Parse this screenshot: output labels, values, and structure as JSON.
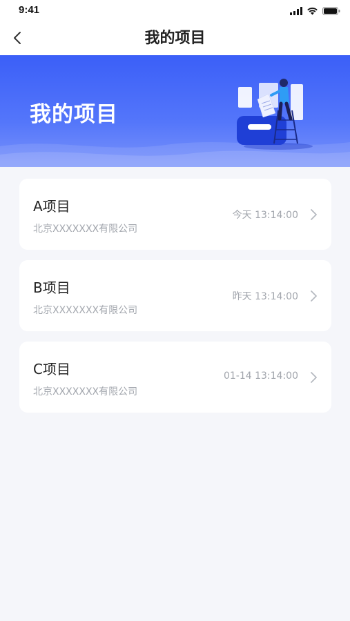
{
  "status_bar": {
    "time": "9:41"
  },
  "nav": {
    "title": "我的项目"
  },
  "banner": {
    "title": "我的项目"
  },
  "projects": [
    {
      "name": "A项目",
      "company": "北京XXXXXXX有限公司",
      "time": "今天 13:14:00"
    },
    {
      "name": "B项目",
      "company": "北京XXXXXXX有限公司",
      "time": "昨天 13:14:00"
    },
    {
      "name": "C项目",
      "company": "北京XXXXXXX有限公司",
      "time": "01-14 13:14:00"
    }
  ],
  "colors": {
    "accent": "#3b5ff8",
    "background": "#f5f6fa",
    "muted_text": "#a2a6ad"
  }
}
